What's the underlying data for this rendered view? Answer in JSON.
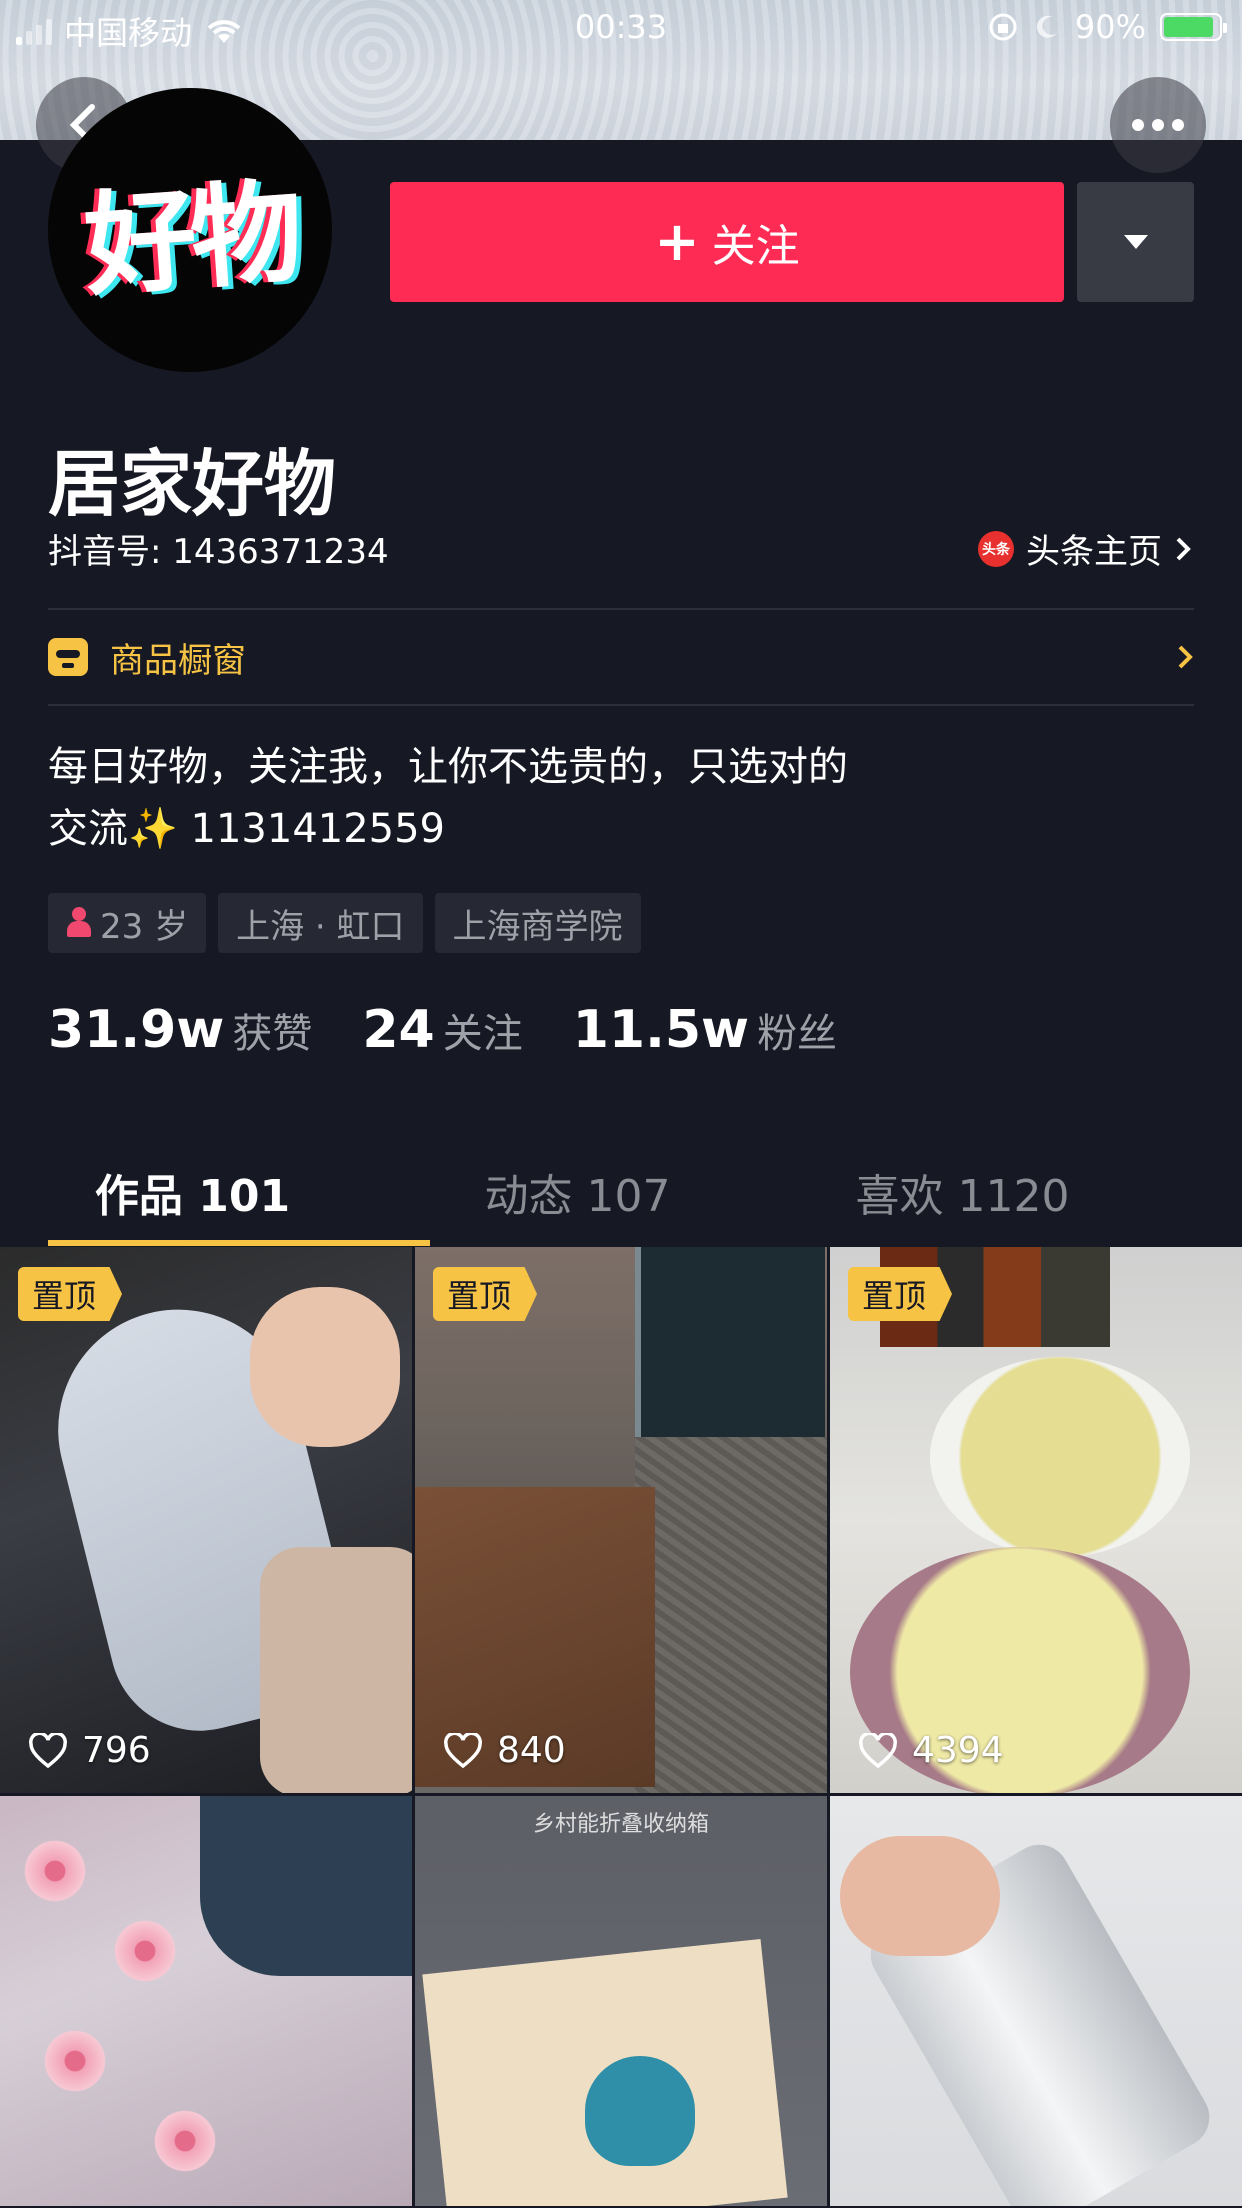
{
  "status_bar": {
    "carrier": "中国移动",
    "time": "00:33",
    "battery": "90%"
  },
  "avatar": {
    "text": "好物"
  },
  "follow": {
    "label": "关注",
    "plus": "+"
  },
  "profile": {
    "name": "居家好物",
    "douyin_id": "抖音号: 1436371234",
    "toutiao_logo": "头条",
    "toutiao_label": "头条主页"
  },
  "shop": {
    "label": "商品橱窗"
  },
  "bio": {
    "line1": "每日好物，关注我，让你不选贵的，只选对的",
    "line2": "交流✨ 1131412559"
  },
  "tags": [
    {
      "label": "23 岁",
      "icon": "female-icon"
    },
    {
      "label": "上海 · 虹口"
    },
    {
      "label": "上海商学院"
    }
  ],
  "stats": [
    {
      "num": "31.9w",
      "label": "获赞"
    },
    {
      "num": "24",
      "label": "关注"
    },
    {
      "num": "11.5w",
      "label": "粉丝"
    }
  ],
  "tabs": [
    {
      "label": "作品 101",
      "active": true
    },
    {
      "label": "动态 107"
    },
    {
      "label": "喜欢 1120"
    }
  ],
  "videos": [
    {
      "pinned": "置顶",
      "likes": "796"
    },
    {
      "pinned": "置顶",
      "likes": "840"
    },
    {
      "pinned": "置顶",
      "likes": "4394"
    },
    {
      "likes": ""
    },
    {
      "caption": "乡村能折叠收纳箱",
      "likes": ""
    },
    {
      "likes": ""
    }
  ],
  "colors": {
    "background": "#161823",
    "follow_button": "#fe2c55",
    "accent_yellow": "#f6c344",
    "secondary_text": "#9fa0a8"
  }
}
